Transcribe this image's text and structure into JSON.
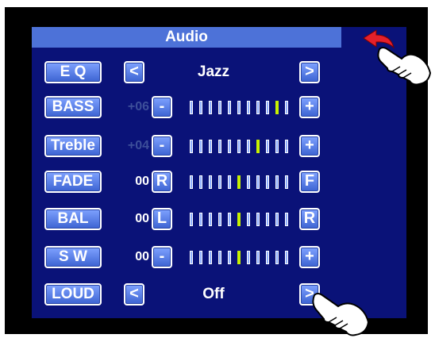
{
  "header": {
    "title": "Audio"
  },
  "rows": [
    {
      "label": "E Q",
      "mode": "select",
      "prev_icon": "<",
      "next_icon": ">",
      "value": "Jazz"
    },
    {
      "label": "BASS",
      "mode": "slider",
      "value": "+06",
      "value_style": "dim",
      "left_icon": "-",
      "right_icon": "+",
      "ticks": 11,
      "active_tick": 10
    },
    {
      "label": "Treble",
      "mode": "slider",
      "value": "+04",
      "value_style": "dim",
      "left_icon": "-",
      "right_icon": "+",
      "ticks": 11,
      "active_tick": 8
    },
    {
      "label": "FADE",
      "mode": "slider",
      "value": "00",
      "value_style": "bright",
      "left_icon": "R",
      "right_icon": "F",
      "ticks": 11,
      "active_tick": 6
    },
    {
      "label": "BAL",
      "mode": "slider",
      "value": "00",
      "value_style": "bright",
      "left_icon": "L",
      "right_icon": "R",
      "ticks": 11,
      "active_tick": 6
    },
    {
      "label": "S W",
      "mode": "slider",
      "value": "00",
      "value_style": "bright",
      "left_icon": "-",
      "right_icon": "+",
      "ticks": 11,
      "active_tick": 6
    },
    {
      "label": "LOUD",
      "mode": "select",
      "prev_icon": "<",
      "next_icon": ">",
      "value": "Off"
    }
  ],
  "icons": {
    "back": "back-arrow-icon",
    "pointer": "pointing-hand-icon"
  },
  "colors": {
    "screen_bg": "#0a1278",
    "titlebar_bg": "#4d72d8",
    "button": "#5b80ea",
    "active_tick": "#c8f000",
    "back_arrow": "#e5202a"
  }
}
